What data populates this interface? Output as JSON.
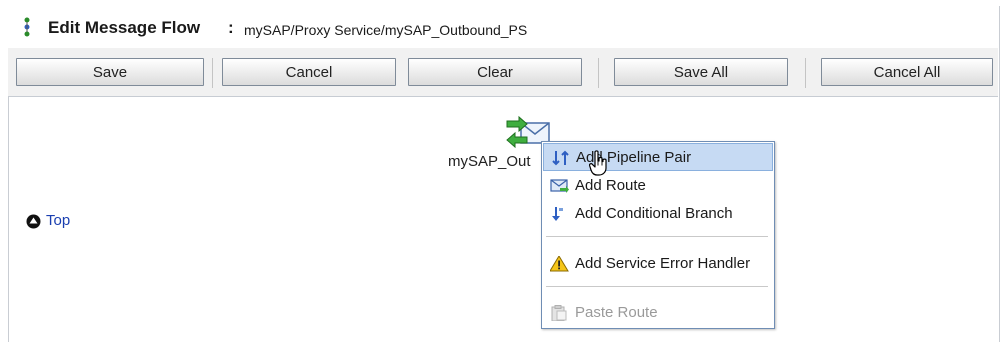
{
  "header": {
    "title": "Edit Message Flow",
    "separator": ":",
    "path": "mySAP/Proxy Service/mySAP_Outbound_PS"
  },
  "toolbar": {
    "save": "Save",
    "cancel": "Cancel",
    "clear": "Clear",
    "save_all": "Save All",
    "cancel_all": "Cancel All"
  },
  "canvas": {
    "node_label": "mySAP_Out",
    "top_link": "Top"
  },
  "context_menu": {
    "items": [
      {
        "label": "Add Pipeline Pair",
        "icon": "pipeline-pair-icon",
        "state": "highlighted"
      },
      {
        "label": "Add Route",
        "icon": "route-icon",
        "state": "normal"
      },
      {
        "label": "Add Conditional Branch",
        "icon": "conditional-branch-icon",
        "state": "normal"
      },
      {
        "label": "Add Service Error Handler",
        "icon": "warning-icon",
        "state": "normal"
      },
      {
        "label": "Paste Route",
        "icon": "paste-icon",
        "state": "disabled"
      }
    ]
  },
  "colors": {
    "menu_highlight": "#c6daf3",
    "link": "#1a3fb0",
    "toolbar_bg": "#f1f1f1",
    "button_border": "#7f8b99"
  }
}
